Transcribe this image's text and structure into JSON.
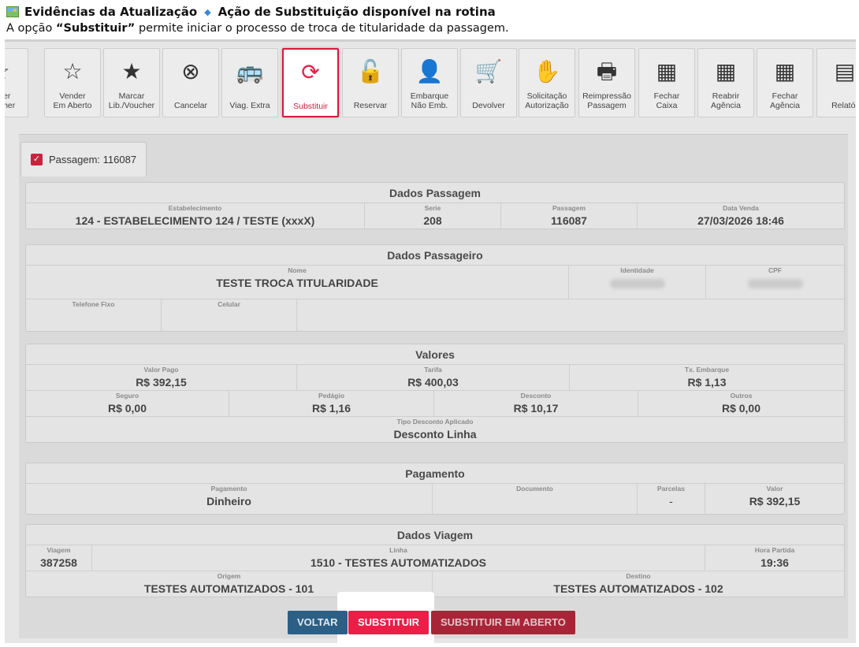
{
  "doc": {
    "title": "Evidências da Atualização",
    "subtitle": "Ação de Substituição disponível na rotina",
    "desc_prefix": "A opção ",
    "desc_bold": "“Substituir”",
    "desc_suffix": " permite iniciar o processo de troca de titularidade da passagem."
  },
  "toolbar": [
    {
      "label1": "ender",
      "label2": "Voucher",
      "icon": "star-outline-icon",
      "glyph": "☆"
    },
    {
      "label1": "Vender",
      "label2": "Em Aberto",
      "icon": "star-outline-icon",
      "glyph": "☆"
    },
    {
      "label1": "Marcar",
      "label2": "Lib./Voucher",
      "icon": "star-filled-icon",
      "glyph": "★"
    },
    {
      "label1": "",
      "label2": "Cancelar",
      "icon": "cancel-circle-icon",
      "glyph": "⊗"
    },
    {
      "label1": "",
      "label2": "Viag. Extra",
      "icon": "bus-icon",
      "glyph": "🚌"
    },
    {
      "label1": "",
      "label2": "Substituir",
      "icon": "refresh-icon",
      "glyph": "⟳"
    },
    {
      "label1": "",
      "label2": "Reservar",
      "icon": "unlock-icon",
      "glyph": "🔓"
    },
    {
      "label1": "Embarque",
      "label2": "Não Emb.",
      "icon": "user-plus-icon",
      "glyph": "👤"
    },
    {
      "label1": "",
      "label2": "Devolver",
      "icon": "cart-icon",
      "glyph": "🛒"
    },
    {
      "label1": "Solicitação",
      "label2": "Autorização",
      "icon": "hand-icon",
      "glyph": "✋"
    },
    {
      "label1": "Reimpressão",
      "label2": "Passagem",
      "icon": "printer-icon",
      "glyph": "🖶"
    },
    {
      "label1": "Fechar",
      "label2": "Caixa",
      "icon": "cash-register-icon",
      "glyph": "▦"
    },
    {
      "label1": "Reabrir",
      "label2": "Agência",
      "icon": "cash-register-icon",
      "glyph": "▦"
    },
    {
      "label1": "Fechar",
      "label2": "Agência",
      "icon": "cash-register-icon",
      "glyph": "▦"
    },
    {
      "label1": "",
      "label2": "Relatór",
      "icon": "document-icon",
      "glyph": "▤"
    }
  ],
  "tab": {
    "label": "Passagem: 116087"
  },
  "dados_passagem": {
    "title": "Dados Passagem",
    "estabelecimento_label": "Estabelecimento",
    "estabelecimento": "124 - ESTABELECIMENTO 124 / TESTE (xxxX)",
    "serie_label": "Serie",
    "serie": "208",
    "passagem_label": "Passagem",
    "passagem": "116087",
    "data_venda_label": "Data Venda",
    "data_venda": "27/03/2026 18:46"
  },
  "dados_passageiro": {
    "title": "Dados Passageiro",
    "nome_label": "Nome",
    "nome": "TESTE TROCA TITULARIDADE",
    "identidade_label": "Identidade",
    "cpf_label": "CPF",
    "telefone_label": "Telefone Fixo",
    "celular_label": "Celular"
  },
  "valores": {
    "title": "Valores",
    "valor_pago_label": "Valor Pago",
    "valor_pago": "R$ 392,15",
    "tarifa_label": "Tarifa",
    "tarifa": "R$ 400,03",
    "tx_embarque_label": "Tx. Embarque",
    "tx_embarque": "R$ 1,13",
    "seguro_label": "Seguro",
    "seguro": "R$ 0,00",
    "pedagio_label": "Pedágio",
    "pedagio": "R$ 1,16",
    "desconto_label": "Desconto",
    "desconto": "R$ 10,17",
    "outros_label": "Outros",
    "outros": "R$ 0,00",
    "tipo_desconto_label": "Tipo Desconto Aplicado",
    "tipo_desconto": "Desconto Linha"
  },
  "pagamento": {
    "title": "Pagamento",
    "pagamento_label": "Pagamento",
    "pagamento": "Dinheiro",
    "documento_label": "Documento",
    "parcelas_label": "Parcelas",
    "parcelas": "-",
    "valor_label": "Valor",
    "valor": "R$ 392,15"
  },
  "dados_viagem": {
    "title": "Dados Viagem",
    "viagem_label": "Viagem",
    "viagem": "387258",
    "linha_label": "Linha",
    "linha": "1510 - TESTES AUTOMATIZADOS",
    "hora_partida_label": "Hora Partida",
    "hora_partida": "19:36",
    "origem_label": "Origem",
    "origem": "TESTES AUTOMATIZADOS - 101",
    "destino_label": "Destino",
    "destino": "TESTES AUTOMATIZADOS - 102"
  },
  "buttons": {
    "voltar": "VOLTAR",
    "substituir": "SUBSTITUIR",
    "substituir_aberto": "SUBSTITUIR EM ABERTO"
  },
  "colors": {
    "accent": "#ea1e47",
    "primary": "#2c5f86"
  }
}
